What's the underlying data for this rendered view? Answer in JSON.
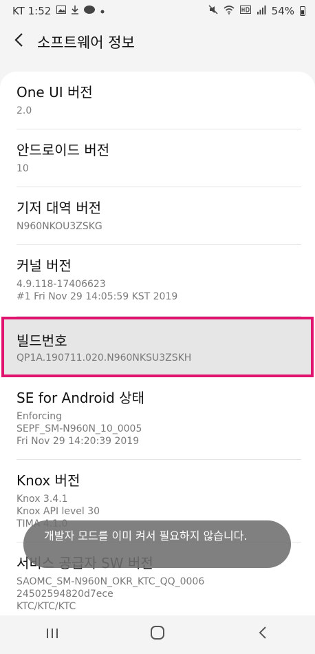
{
  "status_bar": {
    "carrier_time": "KT 1:52",
    "battery": "54%"
  },
  "header": {
    "title": "소프트웨어 정보"
  },
  "rows": [
    {
      "title": "One UI 버전",
      "value": "2.0"
    },
    {
      "title": "안드로이드 버전",
      "value": "10"
    },
    {
      "title": "기저 대역 버전",
      "value": "N960NKOU3ZSKG"
    },
    {
      "title": "커널 버전",
      "value": "4.9.118-17406623\n#1 Fri Nov 29 14:05:59 KST 2019"
    },
    {
      "title": "빌드번호",
      "value": "QP1A.190711.020.N960NKSU3ZSKH"
    },
    {
      "title": "SE for Android 상태",
      "value": "Enforcing\nSEPF_SM-N960N_10_0005\nFri Nov 29 14:20:39 2019"
    },
    {
      "title": "Knox 버전",
      "value": "Knox 3.4.1\nKnox API level 30\nTIMA 4.1.0"
    },
    {
      "title": "서비스 공급자 SW 버전",
      "value": "SAOMC_SM-N960N_OKR_KTC_QQ_0006\n24502594820d7ece\nKTC/KTC/KTC"
    }
  ],
  "toast": {
    "message": "개발자 모드를 이미 켜서 필요하지 않습니다."
  },
  "icons": {
    "back": "chevron-left-icon",
    "recents": "recents-icon",
    "home": "home-icon",
    "nav_back": "back-icon"
  }
}
